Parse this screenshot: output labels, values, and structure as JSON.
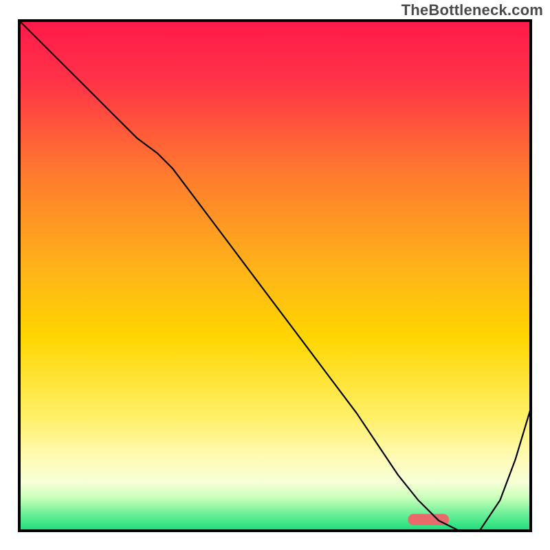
{
  "watermark": "TheBottleneck.com",
  "chart_data": {
    "type": "line",
    "title": "",
    "xlabel": "",
    "ylabel": "",
    "xlim": [
      0,
      100
    ],
    "ylim": [
      0,
      100
    ],
    "background_gradient_stops": [
      {
        "offset": 0.0,
        "color": "#ff1a4b"
      },
      {
        "offset": 0.12,
        "color": "#ff3347"
      },
      {
        "offset": 0.3,
        "color": "#ff7a2e"
      },
      {
        "offset": 0.48,
        "color": "#ffb11a"
      },
      {
        "offset": 0.62,
        "color": "#ffd600"
      },
      {
        "offset": 0.78,
        "color": "#fff06a"
      },
      {
        "offset": 0.86,
        "color": "#fffbb8"
      },
      {
        "offset": 0.905,
        "color": "#f7ffd6"
      },
      {
        "offset": 0.935,
        "color": "#c9ffba"
      },
      {
        "offset": 0.965,
        "color": "#72f09a"
      },
      {
        "offset": 1.0,
        "color": "#18dd7a"
      }
    ],
    "series": [
      {
        "name": "bottleneck-curve",
        "stroke": "#000000",
        "stroke_width": 2.2,
        "x": [
          0,
          6,
          12,
          18,
          23,
          27,
          30,
          36,
          42,
          48,
          54,
          60,
          66,
          70,
          74,
          78,
          82,
          86,
          90,
          94,
          97,
          100
        ],
        "y": [
          100,
          94,
          88,
          82,
          77,
          74,
          71,
          63,
          55,
          47,
          39,
          31,
          23,
          17,
          11,
          6,
          2,
          0,
          0,
          6,
          14,
          24
        ]
      }
    ],
    "marker": {
      "name": "optimal-range-marker",
      "x_start": 76,
      "x_end": 84,
      "y": 2.2,
      "height": 2.2,
      "color": "#e86a6a",
      "radius": 8
    },
    "frame": {
      "stroke": "#000000",
      "stroke_width": 4
    }
  }
}
